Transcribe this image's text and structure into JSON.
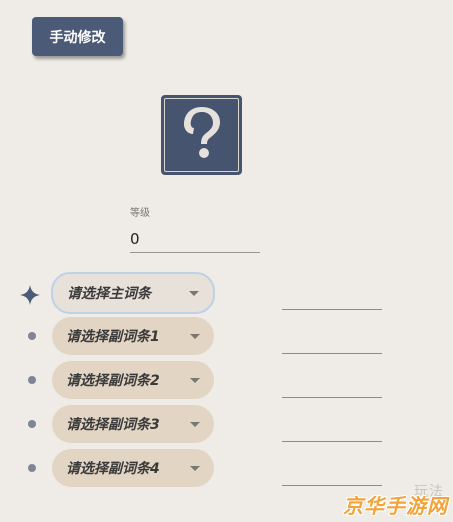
{
  "toolbar": {
    "manual_edit_label": "手动修改"
  },
  "artifact": {
    "icon": "question-mark-icon"
  },
  "level": {
    "label": "等级",
    "value": "0"
  },
  "stats": {
    "main": {
      "label": "请选择主词条",
      "icon": "four-point-star-icon"
    },
    "subs": [
      {
        "label": "请选择副词条1"
      },
      {
        "label": "请选择副词条2"
      },
      {
        "label": "请选择副词条3"
      },
      {
        "label": "请选择副词条4"
      }
    ]
  },
  "watermark": {
    "top_text": "玩法",
    "text": "京华手游网"
  },
  "colors": {
    "background": "#efebe6",
    "button": "#4b5a76",
    "select_fill": "#e3d5c4",
    "select_focus_border": "#bdd1e9",
    "watermark": "#f2a33a"
  }
}
